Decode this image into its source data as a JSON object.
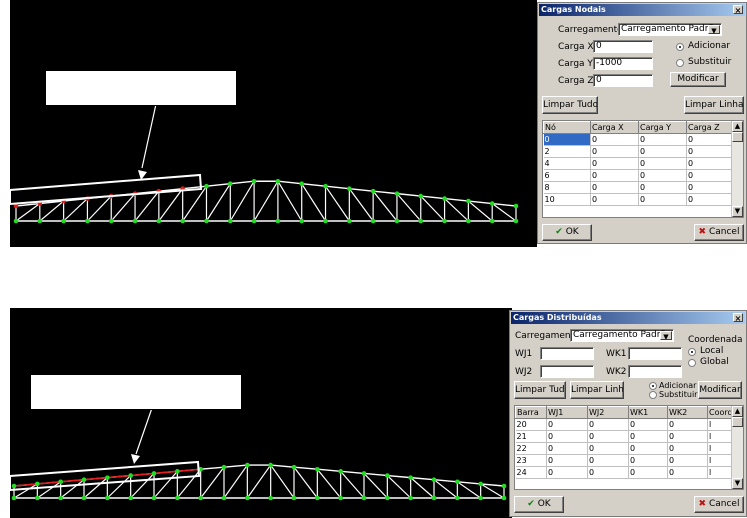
{
  "nodal_dialog": {
    "title": "Cargas Nodais",
    "carregamento_label": "Carregamento",
    "carregamento_value": "Carregamento Padrão",
    "carga_x_label": "Carga X",
    "carga_x_value": "0",
    "carga_y_label": "Carga Y",
    "carga_y_value": "-1000",
    "carga_z_label": "Carga Z",
    "carga_z_value": "0",
    "adicionar_label": "Adicionar",
    "substituir_label": "Substituir",
    "modificar_label": "Modificar",
    "limpar_tudo_label": "Limpar Tudo",
    "limpar_linha_label": "Limpar Linha",
    "columns": [
      "Nó",
      "Carga X",
      "Carga Y",
      "Carga Z"
    ],
    "rows": [
      [
        "0",
        "0",
        "0",
        "0"
      ],
      [
        "2",
        "0",
        "0",
        "0"
      ],
      [
        "4",
        "0",
        "0",
        "0"
      ],
      [
        "6",
        "0",
        "0",
        "0"
      ],
      [
        "8",
        "0",
        "0",
        "0"
      ],
      [
        "10",
        "0",
        "0",
        "0"
      ]
    ],
    "ok_label": "OK",
    "cancel_label": "Cancel"
  },
  "dist_dialog": {
    "title": "Cargas Distribuídas",
    "carregamento_label": "Carregamento",
    "carregamento_value": "Carregamento Padrão",
    "coordenada_label": "Coordenada",
    "local_label": "Local",
    "global_label": "Global",
    "wj1_label": "WJ1",
    "wj2_label": "WJ2",
    "wk1_label": "WK1",
    "wk2_label": "WK2",
    "adicionar_label": "Adicionar",
    "substituir_label": "Substituir",
    "modificar_label": "Modificar",
    "limpar_tudo_label": "Limpar Tudo",
    "limpar_linha_label": "Limpar Linha",
    "columns": [
      "Barra",
      "WJ1",
      "WJ2",
      "WK1",
      "WK2",
      "Coord"
    ],
    "rows": [
      [
        "20",
        "0",
        "0",
        "0",
        "0",
        "l"
      ],
      [
        "21",
        "0",
        "0",
        "0",
        "0",
        "l"
      ],
      [
        "22",
        "0",
        "0",
        "0",
        "0",
        "l"
      ],
      [
        "23",
        "0",
        "0",
        "0",
        "0",
        "l"
      ],
      [
        "24",
        "0",
        "0",
        "0",
        "0",
        "l"
      ]
    ],
    "ok_label": "OK",
    "cancel_label": "Cancel"
  },
  "colors": {
    "viewport": "#000000",
    "member": "#ffffff",
    "node": "#22dd22",
    "loaded_node": "#e02020",
    "selection": "#316ac5"
  },
  "icons": [
    "check-icon",
    "cross-icon",
    "dropdown-arrow-icon",
    "scroll-up-icon",
    "scroll-down-icon",
    "close-icon"
  ]
}
